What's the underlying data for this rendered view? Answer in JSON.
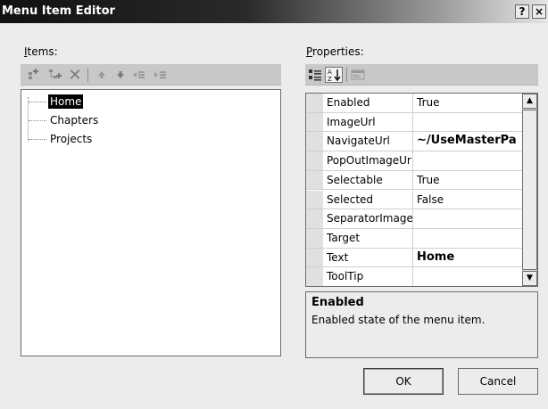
{
  "window": {
    "title": "Menu Item Editor",
    "help_button": "?",
    "close_button": "×"
  },
  "items_panel": {
    "label_accel": "I",
    "label_rest": "tems:",
    "toolbar_icons": [
      "add-root-item-icon",
      "add-child-item-icon",
      "delete-icon",
      "move-up-icon",
      "move-down-icon",
      "indent-left-icon",
      "indent-right-icon"
    ],
    "tree": [
      {
        "label": "Home",
        "selected": true
      },
      {
        "label": "Chapters",
        "selected": false
      },
      {
        "label": "Projects",
        "selected": false
      }
    ]
  },
  "properties_panel": {
    "label_accel": "P",
    "label_rest": "roperties:",
    "toolbar_icons": [
      "categorized-icon",
      "alphabetical-icon",
      "property-pages-icon"
    ],
    "rows": [
      {
        "name": "Enabled",
        "value": "True",
        "bold": false
      },
      {
        "name": "ImageUrl",
        "value": "",
        "bold": false
      },
      {
        "name": "NavigateUrl",
        "value": "~/UseMasterPa",
        "bold": true
      },
      {
        "name": "PopOutImageUrl",
        "value": "",
        "bold": false
      },
      {
        "name": "Selectable",
        "value": "True",
        "bold": false
      },
      {
        "name": "Selected",
        "value": "False",
        "bold": false
      },
      {
        "name": "SeparatorImageUrl",
        "value": "",
        "bold": false
      },
      {
        "name": "Target",
        "value": "",
        "bold": false
      },
      {
        "name": "Text",
        "value": "Home",
        "bold": true
      },
      {
        "name": "ToolTip",
        "value": "",
        "bold": false
      }
    ],
    "description": {
      "title": "Enabled",
      "text": "Enabled state of the menu item."
    }
  },
  "buttons": {
    "ok": "OK",
    "cancel": "Cancel"
  }
}
